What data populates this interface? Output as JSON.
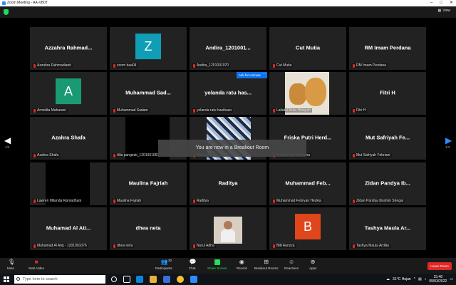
{
  "window": {
    "title": "Zoom Meeting - AA-VB0T"
  },
  "view_button": "View",
  "breakout_toast": "You are now in a Breakout Room",
  "ask_host_label": "Ask for Unmute",
  "ask_host_more": "···",
  "page_indicator_left": "1/3",
  "page_indicator_right": "1/3",
  "participants": [
    {
      "display": "Azzahra Rahmad...",
      "label": "Azzahra Rahmadianti"
    },
    {
      "display": "",
      "label": "zoom baa04",
      "avatar": "Z",
      "avatar_color": "#0f9eb6"
    },
    {
      "display": "Andira_1201001...",
      "label": "Andira_1201001070"
    },
    {
      "display": "Cut Mutia",
      "label": "Cut Mutia"
    },
    {
      "display": "RM Imam Perdana",
      "label": "RM Imam Perdana"
    },
    {
      "display": "",
      "label": "Armelita Maharani",
      "avatar": "A",
      "avatar_color": "#1a9a73"
    },
    {
      "display": "Muhammad Sad...",
      "label": "Muhammad Sadam"
    },
    {
      "display": "yolanda ratu has...",
      "label": "yolanda ratu hasibuan"
    },
    {
      "display": "",
      "label": "Lailatul Azka Hidayah",
      "video": "bears"
    },
    {
      "display": "Fitri H",
      "label": "Fitri H"
    },
    {
      "display": "Azahra Shafa",
      "label": "Azahra Shafa"
    },
    {
      "display": "",
      "label": "Alia pangesti_1201001061",
      "video": "black"
    },
    {
      "display": "",
      "label": "Haikal Azizah",
      "video": "poster"
    },
    {
      "display": "Friska Putri Herd...",
      "label": "Friska Putri Herdiana"
    },
    {
      "display": "Mut Safriyah Fe...",
      "label": "Mut Safriyah Febriani"
    },
    {
      "display": "",
      "label": "Lawren Milanda Ramadhani",
      "video": "black"
    },
    {
      "display": "Maulina Fajriah",
      "label": "Maulina Fajriah"
    },
    {
      "display": "Raditya",
      "label": "Raditya"
    },
    {
      "display": "Muhammad Feb...",
      "label": "Muhammad Febryan Hezkia"
    },
    {
      "display": "Zidan Pandya Ib...",
      "label": "Zidan Pandya Ibrahim Siregar"
    },
    {
      "display": "Muhamad Al Ati...",
      "label": "Muhamad Al Atiq - 1201001076"
    },
    {
      "display": "dhea neta",
      "label": "dhea neta"
    },
    {
      "display": "",
      "label": "Nurul Adha",
      "video": "person"
    },
    {
      "display": "",
      "label": "Billi Aurizza",
      "avatar": "B",
      "avatar_color": "#e0461c"
    },
    {
      "display": "Tashya Maula Ar...",
      "label": "Tashya Maula Ardilia"
    }
  ],
  "toolbar": {
    "mute": "Mute",
    "start_video": "Start Video",
    "participants": "Participants",
    "participants_count": "30",
    "chat": "Chat",
    "share_screen": "Share Screen",
    "record": "Record",
    "breakout_rooms": "Breakout Rooms",
    "reactions": "Reactions",
    "apps": "Apps",
    "leave": "Leave Room"
  },
  "taskbar": {
    "search_placeholder": "Type here to search",
    "weather": "31°C Hujan",
    "time": "15:48",
    "date": "09/03/2022"
  },
  "colors": {
    "share_green": "#23d959",
    "leave_red": "#e02828",
    "accent_blue": "#0e72ed"
  }
}
